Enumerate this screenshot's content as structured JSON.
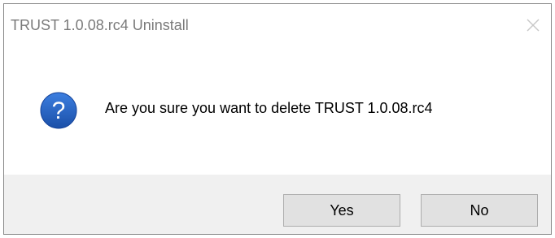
{
  "window": {
    "title": "TRUST 1.0.08.rc4 Uninstall",
    "close_icon": "close-icon"
  },
  "content": {
    "icon": "question-icon",
    "message": "Are you sure you want to delete TRUST 1.0.08.rc4"
  },
  "buttons": {
    "yes_label": "Yes",
    "no_label": "No"
  },
  "colors": {
    "icon_blue": "#1f5fbf",
    "footer_bg": "#f0f0f0",
    "button_bg": "#e1e1e1",
    "title_text": "#7a7a7a"
  }
}
